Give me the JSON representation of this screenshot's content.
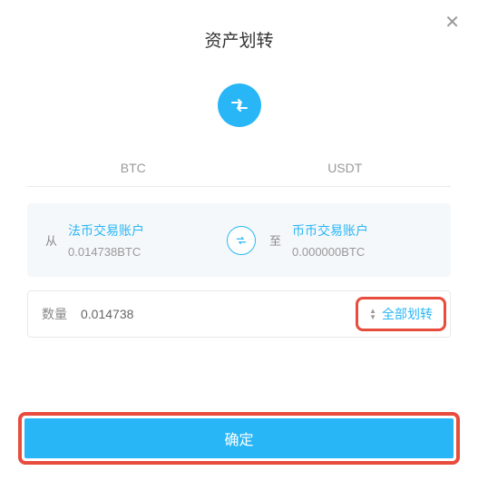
{
  "modal": {
    "title": "资产划转"
  },
  "tabs": {
    "btc": "BTC",
    "usdt": "USDT"
  },
  "transfer": {
    "from_label": "从",
    "from_account": "法币交易账户",
    "from_balance": "0.014738BTC",
    "to_label": "至",
    "to_account": "币币交易账户",
    "to_balance": "0.000000BTC"
  },
  "amount": {
    "label": "数量",
    "value": "0.014738",
    "all_label": "全部划转"
  },
  "confirm": {
    "label": "确定"
  }
}
